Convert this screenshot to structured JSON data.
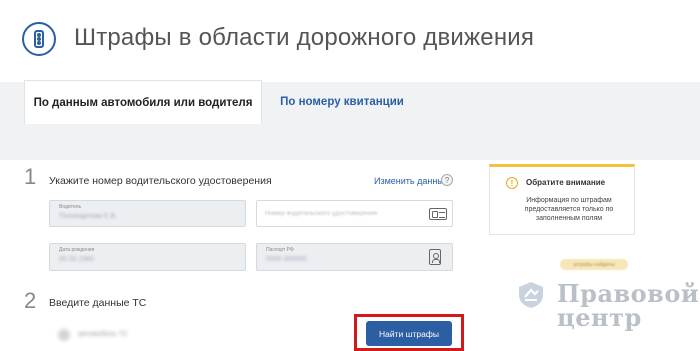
{
  "header": {
    "title": "Штрафы в области дорожного движения",
    "icon": "traffic-light-icon"
  },
  "tabs": [
    {
      "label": "По данным автомобиля или водителя",
      "active": true
    },
    {
      "label": "По номеру квитанции",
      "active": false
    }
  ],
  "step1": {
    "number": "1",
    "label": "Укажите номер водительского удостоверения",
    "change_link": "Изменить данные",
    "help": "?",
    "fields": {
      "driver": {
        "label": "Водитель",
        "value": "Поликарпова Е.В."
      },
      "license": {
        "placeholder": "Номер водительского удостоверения"
      },
      "birthdate": {
        "label": "Дата рождения",
        "value": "00.00.1980"
      },
      "passport": {
        "label": "Паспорт РФ",
        "value": "0000 000000"
      }
    }
  },
  "notice": {
    "title": "Обратите внимание",
    "text": "Информация по штрафам предоставляется только по заполненным полям",
    "icon_glyph": "!",
    "accent": "#f4c23a"
  },
  "ghost_badge": "штрафы найдены",
  "step2": {
    "number": "2",
    "label": "Введите данные ТС",
    "vehicle_value": "автомобиль ТС"
  },
  "find_button": {
    "label": "Найти штрафы",
    "color": "#2c5ea3",
    "highlight": "#d31a1a"
  },
  "watermark": {
    "line1": "Правовой",
    "line2": "центр"
  }
}
